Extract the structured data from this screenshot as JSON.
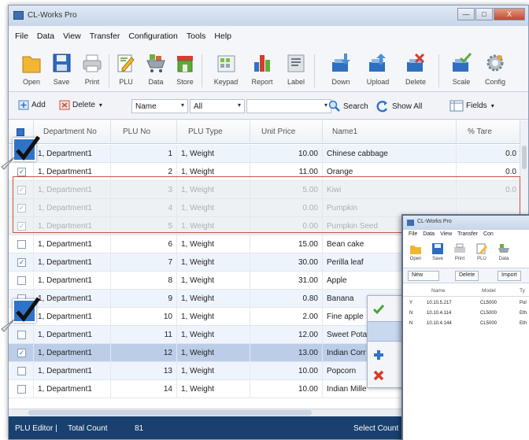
{
  "window": {
    "title": "CL-Works Pro",
    "controls": {
      "minimize": "—",
      "maximize": "□",
      "close": "X"
    }
  },
  "menu": [
    "File",
    "Data",
    "View",
    "Transfer",
    "Configuration",
    "Tools",
    "Help"
  ],
  "toolbar": [
    {
      "label": "Open",
      "icon": "folder-icon"
    },
    {
      "label": "Save",
      "icon": "floppy-icon"
    },
    {
      "label": "Print",
      "icon": "printer-icon"
    },
    {
      "label": "PLU",
      "icon": "plu-edit-icon"
    },
    {
      "label": "Data",
      "icon": "cart-icon"
    },
    {
      "label": "Store",
      "icon": "store-icon"
    },
    {
      "label": "Keypad",
      "icon": "keypad-icon"
    },
    {
      "label": "Report",
      "icon": "bar-chart-icon"
    },
    {
      "label": "Label",
      "icon": "label-icon"
    },
    {
      "label": "Down",
      "icon": "download-icon"
    },
    {
      "label": "Upload",
      "icon": "upload-icon"
    },
    {
      "label": "Delete",
      "icon": "delete-icon"
    },
    {
      "label": "Scale",
      "icon": "scale-icon"
    },
    {
      "label": "Config",
      "icon": "config-gear-icon"
    }
  ],
  "filterbar": {
    "add_label": "Add",
    "delete_label": "Delete",
    "field_select": "Name",
    "scope_select": "All",
    "search_label": "Search",
    "show_all_label": "Show All",
    "fields_label": "Fields"
  },
  "grid": {
    "columns": [
      "Department No",
      "PLU No",
      "PLU Type",
      "Unit Price",
      "Name1",
      "% Tare"
    ],
    "rows": [
      {
        "checked": true,
        "dept": "1, Department1",
        "plu": "1",
        "type": "1, Weight",
        "price": "10.00",
        "name": "Chinese cabbage",
        "tare": "0.0"
      },
      {
        "checked": true,
        "dept": "1, Department1",
        "plu": "2",
        "type": "1, Weight",
        "price": "11.00",
        "name": "Orange",
        "tare": "0.0"
      },
      {
        "checked": true,
        "dept": "1, Department1",
        "plu": "3",
        "type": "1, Weight",
        "price": "5.00",
        "name": "Kiwi",
        "tare": "0.0"
      },
      {
        "checked": true,
        "dept": "1, Department1",
        "plu": "4",
        "type": "1, Weight",
        "price": "0.00",
        "name": "Pumpkin",
        "tare": ""
      },
      {
        "checked": true,
        "dept": "1, Department1",
        "plu": "5",
        "type": "1, Weight",
        "price": "0.00",
        "name": "Pumpkin Seed",
        "tare": ""
      },
      {
        "checked": false,
        "dept": "1, Department1",
        "plu": "6",
        "type": "1, Weight",
        "price": "15.00",
        "name": "Bean cake",
        "tare": ""
      },
      {
        "checked": true,
        "dept": "1, Department1",
        "plu": "7",
        "type": "1, Weight",
        "price": "30.00",
        "name": "Perilla leaf",
        "tare": ""
      },
      {
        "checked": false,
        "dept": "1, Department1",
        "plu": "8",
        "type": "1, Weight",
        "price": "31.00",
        "name": "Apple",
        "tare": ""
      },
      {
        "checked": false,
        "dept": "1, Department1",
        "plu": "9",
        "type": "1, Weight",
        "price": "0.80",
        "name": "Banana",
        "tare": ""
      },
      {
        "checked": true,
        "dept": "1, Department1",
        "plu": "10",
        "type": "1, Weight",
        "price": "2.00",
        "name": "Fine apple",
        "tare": ""
      },
      {
        "checked": false,
        "dept": "1, Department1",
        "plu": "11",
        "type": "1, Weight",
        "price": "12.00",
        "name": "Sweet Pota",
        "tare": ""
      },
      {
        "checked": true,
        "dept": "1, Department1",
        "plu": "12",
        "type": "1, Weight",
        "price": "13.00",
        "name": "Indian Corr",
        "tare": ""
      },
      {
        "checked": false,
        "dept": "1, Department1",
        "plu": "13",
        "type": "1, Weight",
        "price": "10.00",
        "name": "Popcorn",
        "tare": ""
      },
      {
        "checked": false,
        "dept": "1, Department1",
        "plu": "14",
        "type": "1, Weight",
        "price": "10.00",
        "name": "Indian Mille",
        "tare": ""
      }
    ]
  },
  "status": {
    "editor_label": "PLU Editor |",
    "total_label": "Total Count",
    "total_value": "81",
    "select_label": "Select Count"
  },
  "window2": {
    "title": "CL-Works Pro",
    "menu": [
      "File",
      "Data",
      "View",
      "Transfer",
      "Con"
    ],
    "toolbar": [
      "Open",
      "Save",
      "Print",
      "PLU",
      "Data"
    ],
    "buttons": [
      "New",
      "Delete",
      "Import"
    ],
    "columns": [
      "Name",
      "Model",
      "Ty"
    ],
    "rows": [
      {
        "flag": "Y",
        "name": "10.10.5.217",
        "model": "CL5000",
        "type": "Pol"
      },
      {
        "flag": "N",
        "name": "10.10.4.114",
        "model": "CL5000",
        "type": "Eth"
      },
      {
        "flag": "N",
        "name": "10.10.4.144",
        "model": "CL5000",
        "type": "Eth"
      }
    ]
  },
  "colors": {
    "accent": "#2f73c9",
    "status_bar": "#19406e",
    "highlight_frame": "#c4543f",
    "selected_row": "#bccde8"
  }
}
